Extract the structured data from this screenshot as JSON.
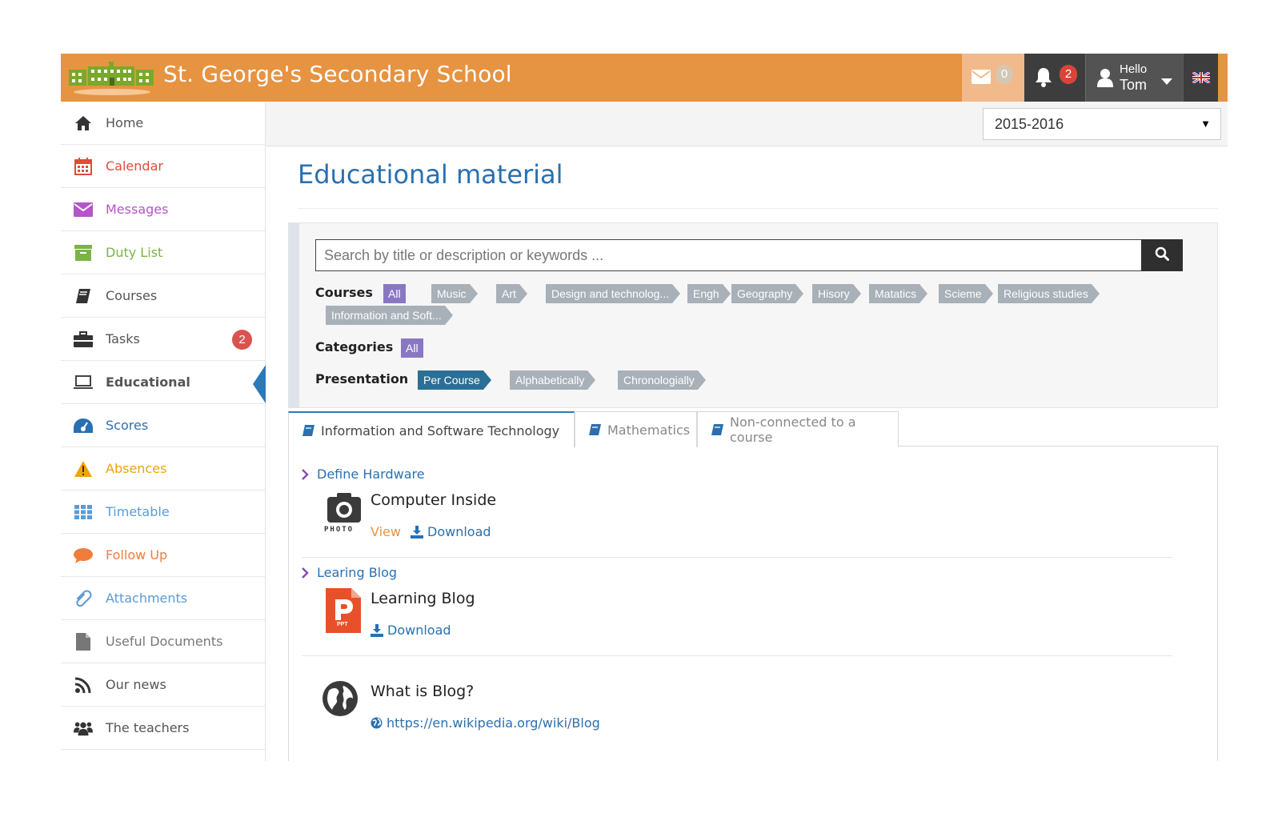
{
  "header": {
    "school_name": "St. George's Secondary School",
    "messages_count": "0",
    "notifications_count": "2",
    "greeting": "Hello",
    "user_name": "Tom",
    "accent_color": "#e69342"
  },
  "sidebar": {
    "items": [
      {
        "label": "Home",
        "icon": "home-icon",
        "color": "#555555"
      },
      {
        "label": "Calendar",
        "icon": "calendar-icon",
        "color": "#e04b3c"
      },
      {
        "label": "Messages",
        "icon": "envelope-icon",
        "color": "#b455c8"
      },
      {
        "label": "Duty List",
        "icon": "archive-icon",
        "color": "#7cb342"
      },
      {
        "label": "Courses",
        "icon": "book-icon",
        "color": "#555555"
      },
      {
        "label": "Tasks",
        "icon": "briefcase-icon",
        "color": "#555555",
        "badge": "2"
      },
      {
        "label": "Educational",
        "icon": "laptop-icon",
        "color": "#555555",
        "active": true
      },
      {
        "label": "Scores",
        "icon": "dashboard-icon",
        "color": "#2a70b0"
      },
      {
        "label": "Absences",
        "icon": "warning-icon",
        "color": "#f0a30a"
      },
      {
        "label": "Timetable",
        "icon": "grid-icon",
        "color": "#5b9bd5"
      },
      {
        "label": "Follow Up",
        "icon": "comment-icon",
        "color": "#f07d3c"
      },
      {
        "label": "Attachments",
        "icon": "paperclip-icon",
        "color": "#5b9bd5"
      },
      {
        "label": "Useful Documents",
        "icon": "file-icon",
        "color": "#777777"
      },
      {
        "label": "Our news",
        "icon": "rss-icon",
        "color": "#555555"
      },
      {
        "label": "The teachers",
        "icon": "users-icon",
        "color": "#555555"
      }
    ]
  },
  "topbar": {
    "year": "2015-2016"
  },
  "main": {
    "title": "Educational material",
    "search": {
      "placeholder": "Search by title or description or keywords ..."
    },
    "filters": {
      "courses_label": "Courses",
      "categories_label": "Categories",
      "presentation_label": "Presentation",
      "all_label": "All",
      "courses": [
        "Music",
        "Art",
        "Design and technolog...",
        "Engh",
        "Geography",
        "Hisory",
        "Matatics",
        "Scieme",
        "Religious studies",
        "Information and Soft..."
      ],
      "presentation": [
        "Per Course",
        "Alphabetically",
        "Chronologially"
      ],
      "presentation_selected": "Per Course"
    },
    "tabs": [
      {
        "label": "Information and Software Technology",
        "active": true
      },
      {
        "label": "Mathematics",
        "active": false
      },
      {
        "label": "Non-connected to a course",
        "active": false
      }
    ],
    "sections": [
      {
        "header": "Define Hardware",
        "item_title": "Computer Inside",
        "file_type_label": "PHOTO",
        "view_label": "View",
        "download_label": "Download"
      },
      {
        "header": "Learing Blog",
        "item_title": "Learning Blog",
        "file_type_label": "PPT",
        "download_label": "Download"
      },
      {
        "item_title": "What is Blog?",
        "link_label": "https://en.wikipedia.org/wiki/Blog"
      }
    ]
  }
}
